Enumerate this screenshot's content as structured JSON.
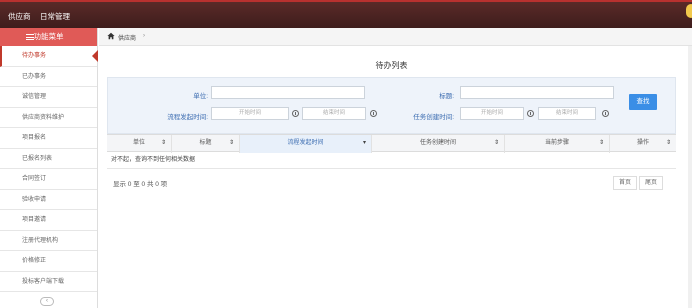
{
  "topbar": {
    "nav": [
      "供应商",
      "日常管理"
    ]
  },
  "sidebar": {
    "header": "功能菜单",
    "items": [
      {
        "label": "待办事务",
        "active": true
      },
      {
        "label": "已办事务",
        "active": false
      },
      {
        "label": "诚信管理",
        "active": false
      },
      {
        "label": "供应商资料维护",
        "active": false
      },
      {
        "label": "项目报名",
        "active": false
      },
      {
        "label": "已报名列表",
        "active": false
      },
      {
        "label": "合同签订",
        "active": false
      },
      {
        "label": "验收申请",
        "active": false
      },
      {
        "label": "项目邀请",
        "active": false
      },
      {
        "label": "注册代理机构",
        "active": false
      },
      {
        "label": "价格修正",
        "active": false
      },
      {
        "label": "投标客户端下载",
        "active": false
      }
    ],
    "collapse_icon": "chevron-left-icon"
  },
  "breadcrumb": {
    "home_icon": "home-icon",
    "text": "供应商",
    "separator": "›"
  },
  "main": {
    "title": "待办列表",
    "filters": {
      "unit_label": "单位:",
      "title_label": "标题:",
      "flow_time_label": "流程发起时间:",
      "task_time_label": "任务创建时间:",
      "start_placeholder": "开始时间",
      "end_placeholder": "结束时间",
      "search_button": "查找"
    },
    "table": {
      "columns": [
        {
          "label": "单位",
          "sort": "⇕"
        },
        {
          "label": "标题",
          "sort": "⇕"
        },
        {
          "label": "流程发起时间",
          "sort": "▾"
        },
        {
          "label": "任务创建时间",
          "sort": "⇕"
        },
        {
          "label": "当前步骤",
          "sort": "⇕"
        },
        {
          "label": "操作",
          "sort": "⇕"
        }
      ],
      "empty_message": "对不起，查询不到任何相关数据"
    },
    "pagination": {
      "info": "显示 0 至 0 共 0 项",
      "first": "首页",
      "last": "尾页"
    }
  },
  "colors": {
    "topbar": "#4a2322",
    "accent": "#c0392b",
    "sidebar_header": "#e05a57",
    "link_blue": "#3a6bb0",
    "button_blue": "#3a8ee6"
  }
}
